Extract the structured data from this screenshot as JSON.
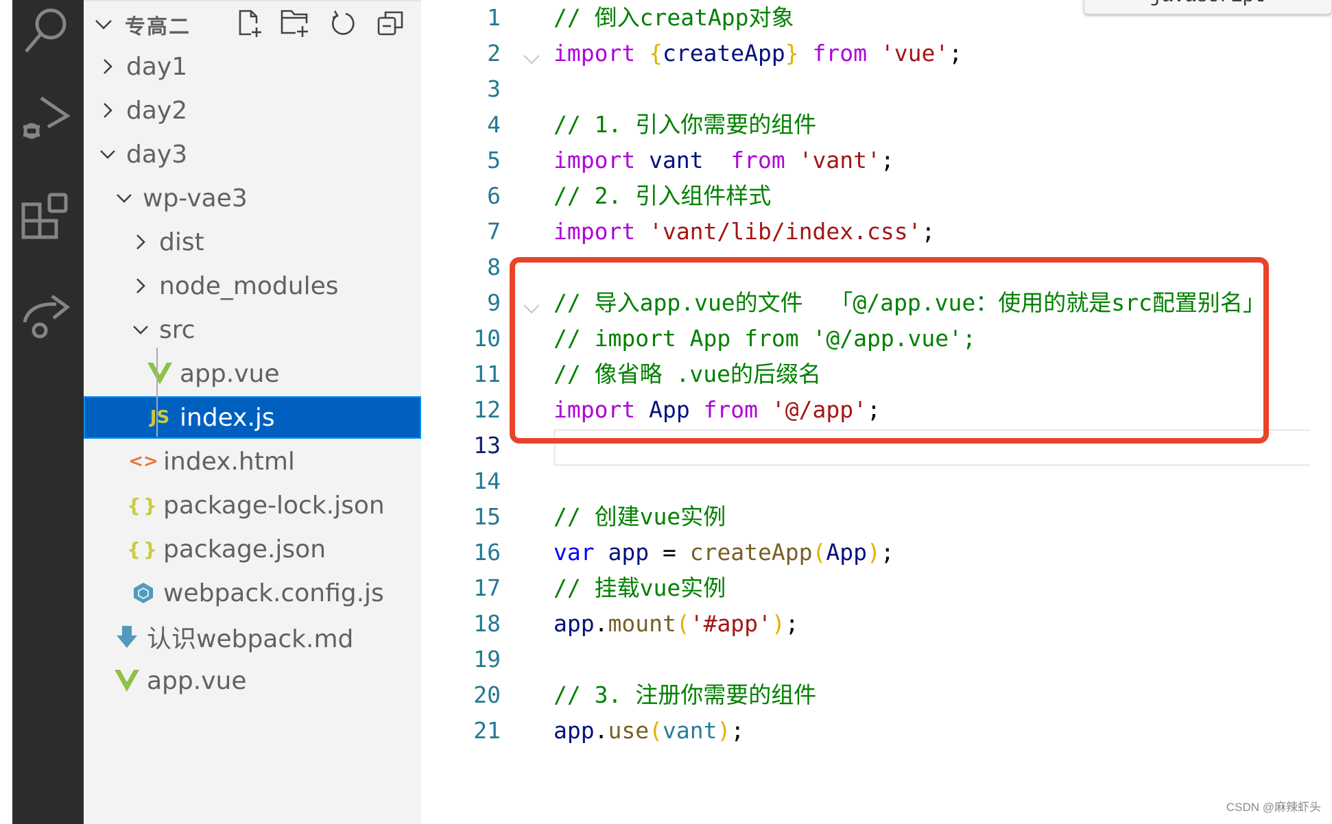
{
  "activity_bar": {
    "icons": [
      "search-icon",
      "run-debug-icon",
      "extensions-icon",
      "share-icon"
    ]
  },
  "explorer": {
    "title": "专高二",
    "header_actions": [
      {
        "name": "new-file-icon",
        "label": "New File"
      },
      {
        "name": "new-folder-icon",
        "label": "New Folder"
      },
      {
        "name": "refresh-icon",
        "label": "Refresh"
      },
      {
        "name": "collapse-all-icon",
        "label": "Collapse All"
      }
    ],
    "tree": [
      {
        "label": "day1",
        "type": "folder",
        "expanded": false,
        "depth": 1
      },
      {
        "label": "day2",
        "type": "folder",
        "expanded": false,
        "depth": 1
      },
      {
        "label": "day3",
        "type": "folder",
        "expanded": true,
        "depth": 1
      },
      {
        "label": "wp-vae3",
        "type": "folder",
        "expanded": true,
        "depth": 2
      },
      {
        "label": "dist",
        "type": "folder",
        "expanded": false,
        "depth": 3
      },
      {
        "label": "node_modules",
        "type": "folder",
        "expanded": false,
        "depth": 3
      },
      {
        "label": "src",
        "type": "folder",
        "expanded": true,
        "depth": 3
      },
      {
        "label": "app.vue",
        "type": "vue",
        "depth": 4
      },
      {
        "label": "index.js",
        "type": "js",
        "depth": 4,
        "selected": true
      },
      {
        "label": "index.html",
        "type": "html",
        "depth": 3
      },
      {
        "label": "package-lock.json",
        "type": "json",
        "depth": 3
      },
      {
        "label": "package.json",
        "type": "json",
        "depth": 3
      },
      {
        "label": "webpack.config.js",
        "type": "webpack",
        "depth": 3
      },
      {
        "label": "认识webpack.md",
        "type": "markdown",
        "depth": 2
      },
      {
        "label": "app.vue",
        "type": "vue",
        "depth": 2
      }
    ],
    "icon_glyphs": {
      "js": "JS",
      "html": "<>",
      "json": "{}"
    }
  },
  "editor": {
    "language_tooltip": "javascript",
    "current_line": 13,
    "lines": [
      {
        "n": "1",
        "tokens": [
          {
            "t": "// 倒入creatApp对象",
            "c": "comment"
          }
        ]
      },
      {
        "n": "2",
        "fold": true,
        "tokens": [
          {
            "t": "import ",
            "c": "keyword"
          },
          {
            "t": "{",
            "c": "brace"
          },
          {
            "t": "createApp",
            "c": "ident"
          },
          {
            "t": "}",
            "c": "brace"
          },
          {
            "t": " from ",
            "c": "keyword"
          },
          {
            "t": "'vue'",
            "c": "string"
          },
          {
            "t": ";",
            "c": "punc"
          }
        ]
      },
      {
        "n": "3",
        "tokens": []
      },
      {
        "n": "4",
        "tokens": [
          {
            "t": "// 1. 引入你需要的组件",
            "c": "comment"
          }
        ]
      },
      {
        "n": "5",
        "tokens": [
          {
            "t": "import ",
            "c": "keyword"
          },
          {
            "t": "vant",
            "c": "ident"
          },
          {
            "t": "  from ",
            "c": "keyword"
          },
          {
            "t": "'vant'",
            "c": "string"
          },
          {
            "t": ";",
            "c": "punc"
          }
        ]
      },
      {
        "n": "6",
        "tokens": [
          {
            "t": "// 2. 引入组件样式",
            "c": "comment"
          }
        ]
      },
      {
        "n": "7",
        "tokens": [
          {
            "t": "import ",
            "c": "keyword"
          },
          {
            "t": "'vant/lib/index.css'",
            "c": "string"
          },
          {
            "t": ";",
            "c": "punc"
          }
        ]
      },
      {
        "n": "8",
        "tokens": []
      },
      {
        "n": "9",
        "fold": true,
        "tokens": [
          {
            "t": "// 导入app.vue的文件  「@/app.vue：使用的就是src配置别名」",
            "c": "comment"
          }
        ]
      },
      {
        "n": "10",
        "tokens": [
          {
            "t": "// import App from '@/app.vue';",
            "c": "comment"
          }
        ]
      },
      {
        "n": "11",
        "tokens": [
          {
            "t": "// 像省略 .vue的后缀名",
            "c": "comment"
          }
        ]
      },
      {
        "n": "12",
        "tokens": [
          {
            "t": "import ",
            "c": "keyword"
          },
          {
            "t": "App",
            "c": "ident"
          },
          {
            "t": " from ",
            "c": "keyword"
          },
          {
            "t": "'@/app'",
            "c": "string"
          },
          {
            "t": ";",
            "c": "punc"
          }
        ]
      },
      {
        "n": "13",
        "tokens": []
      },
      {
        "n": "14",
        "tokens": []
      },
      {
        "n": "15",
        "tokens": [
          {
            "t": "// 创建vue实例",
            "c": "comment"
          }
        ]
      },
      {
        "n": "16",
        "tokens": [
          {
            "t": "var ",
            "c": "var"
          },
          {
            "t": "app",
            "c": "ident"
          },
          {
            "t": " = ",
            "c": "punc"
          },
          {
            "t": "createApp",
            "c": "func"
          },
          {
            "t": "(",
            "c": "brace"
          },
          {
            "t": "App",
            "c": "ident"
          },
          {
            "t": ")",
            "c": "brace"
          },
          {
            "t": ";",
            "c": "punc"
          }
        ]
      },
      {
        "n": "17",
        "tokens": [
          {
            "t": "// 挂载vue实例",
            "c": "comment"
          }
        ]
      },
      {
        "n": "18",
        "tokens": [
          {
            "t": "app",
            "c": "ident"
          },
          {
            "t": ".",
            "c": "punc"
          },
          {
            "t": "mount",
            "c": "func"
          },
          {
            "t": "(",
            "c": "brace"
          },
          {
            "t": "'#app'",
            "c": "string"
          },
          {
            "t": ")",
            "c": "brace"
          },
          {
            "t": ";",
            "c": "punc"
          }
        ]
      },
      {
        "n": "19",
        "tokens": []
      },
      {
        "n": "20",
        "tokens": [
          {
            "t": "// 3. 注册你需要的组件",
            "c": "comment"
          }
        ]
      },
      {
        "n": "21",
        "tokens": [
          {
            "t": "app",
            "c": "ident"
          },
          {
            "t": ".",
            "c": "punc"
          },
          {
            "t": "use",
            "c": "func"
          },
          {
            "t": "(",
            "c": "brace"
          },
          {
            "t": "vant",
            "c": "param"
          },
          {
            "t": ")",
            "c": "brace"
          },
          {
            "t": ";",
            "c": "punc"
          }
        ]
      }
    ],
    "annotation": {
      "color": "#e8442a",
      "from_line": 8,
      "to_line": 12
    }
  },
  "colors": {
    "selection": "#0060c0",
    "comment": "#008000",
    "keyword": "#af00db",
    "string": "#a31515",
    "line_number": "#237893"
  },
  "watermark": "CSDN @麻辣虾头"
}
